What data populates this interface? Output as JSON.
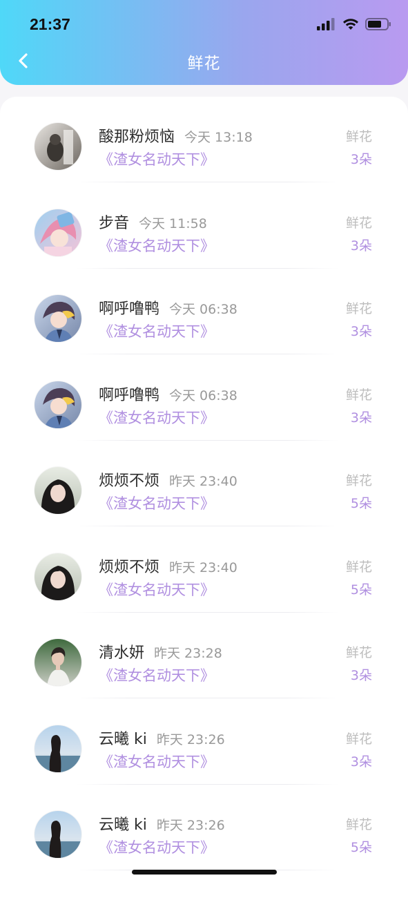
{
  "status_bar": {
    "time": "21:37"
  },
  "header": {
    "title": "鲜花",
    "back_icon": "chevron-left-icon"
  },
  "colors": {
    "accent": "#b08fe0",
    "gradient_start": "#4fd8f8",
    "gradient_end": "#b99af0"
  },
  "rows": [
    {
      "name": "酸那粉烦恼",
      "time": "今天 13:18",
      "book": "《渣女名动天下》",
      "gift_label": "鲜花",
      "gift_count": "3朵",
      "avatar": "avatar-photo-pet"
    },
    {
      "name": "步音",
      "time": "今天 11:58",
      "book": "《渣女名动天下》",
      "gift_label": "鲜花",
      "gift_count": "3朵",
      "avatar": "avatar-anime-pink-hair"
    },
    {
      "name": "啊呼噜鸭",
      "time": "今天 06:38",
      "book": "《渣女名动天下》",
      "gift_label": "鲜花",
      "gift_count": "3朵",
      "avatar": "avatar-anime-boy"
    },
    {
      "name": "啊呼噜鸭",
      "time": "今天 06:38",
      "book": "《渣女名动天下》",
      "gift_label": "鲜花",
      "gift_count": "3朵",
      "avatar": "avatar-anime-boy"
    },
    {
      "name": "烦烦不烦",
      "time": "昨天 23:40",
      "book": "《渣女名动天下》",
      "gift_label": "鲜花",
      "gift_count": "5朵",
      "avatar": "avatar-photo-girl"
    },
    {
      "name": "烦烦不烦",
      "time": "昨天 23:40",
      "book": "《渣女名动天下》",
      "gift_label": "鲜花",
      "gift_count": "5朵",
      "avatar": "avatar-photo-girl"
    },
    {
      "name": "清水妍",
      "time": "昨天 23:28",
      "book": "《渣女名动天下》",
      "gift_label": "鲜花",
      "gift_count": "3朵",
      "avatar": "avatar-photo-man"
    },
    {
      "name": "云曦 ki",
      "time": "昨天 23:26",
      "book": "《渣女名动天下》",
      "gift_label": "鲜花",
      "gift_count": "3朵",
      "avatar": "avatar-photo-beach"
    },
    {
      "name": "云曦 ki",
      "time": "昨天 23:26",
      "book": "《渣女名动天下》",
      "gift_label": "鲜花",
      "gift_count": "5朵",
      "avatar": "avatar-photo-beach"
    }
  ]
}
